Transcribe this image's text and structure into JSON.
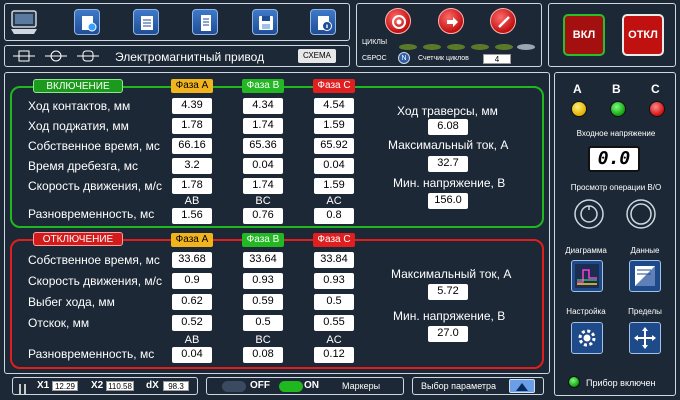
{
  "header": {
    "title": "Электромагнитный привод",
    "scheme_label": "СХЕМА",
    "cycles_label": "ЦИКЛЫ",
    "reset_label": "СБРОС",
    "reset_badge": "N",
    "counter_label": "Счетчик циклов",
    "counter_value": "4",
    "on_label": "ВКЛ",
    "off_label": "ОТКЛ"
  },
  "inclusion": {
    "title": "ВКЛЮЧЕНИЕ",
    "phases": [
      "Фаза A",
      "Фаза B",
      "Фаза C"
    ],
    "rows": [
      {
        "label": "Ход контактов, мм",
        "values": [
          "4.39",
          "4.34",
          "4.54"
        ]
      },
      {
        "label": "Ход поджатия, мм",
        "values": [
          "1.78",
          "1.74",
          "1.59"
        ]
      },
      {
        "label": "Собственное время, мс",
        "values": [
          "66.16",
          "65.36",
          "65.92"
        ]
      },
      {
        "label": "Время дребезга, мс",
        "values": [
          "3.2",
          "0.04",
          "0.04"
        ]
      },
      {
        "label": "Скорость движения, м/с",
        "values": [
          "1.78",
          "1.74",
          "1.59"
        ]
      }
    ],
    "diff_label": "Разновременность, мс",
    "diff_headers": [
      "AB",
      "BC",
      "AC"
    ],
    "diff_values": [
      "1.56",
      "0.76",
      "0.8"
    ],
    "traverse_label": "Ход траверсы, мм",
    "traverse_value": "6.08",
    "max_current_label": "Максимальный ток, А",
    "max_current_value": "32.7",
    "min_voltage_label": "Мин. напряжение, В",
    "min_voltage_value": "156.0"
  },
  "shutdown": {
    "title": "ОТКЛЮЧЕНИЕ",
    "phases": [
      "Фаза A",
      "Фаза B",
      "Фаза C"
    ],
    "rows": [
      {
        "label": "Собственное время, мс",
        "values": [
          "33.68",
          "33.64",
          "33.84"
        ]
      },
      {
        "label": "Скорость движения, м/с",
        "values": [
          "0.9",
          "0.93",
          "0.93"
        ]
      },
      {
        "label": "Выбег хода, мм",
        "values": [
          "0.62",
          "0.59",
          "0.5"
        ]
      },
      {
        "label": "Отскок, мм",
        "values": [
          "0.52",
          "0.5",
          "0.55"
        ]
      }
    ],
    "diff_label": "Разновременность, мс",
    "diff_headers": [
      "AB",
      "BC",
      "AC"
    ],
    "diff_values": [
      "0.04",
      "0.08",
      "0.12"
    ],
    "max_current_label": "Максимальный ток, А",
    "max_current_value": "5.72",
    "min_voltage_label": "Мин. напряжение, В",
    "min_voltage_value": "27.0"
  },
  "right": {
    "phase_letters": [
      "A",
      "B",
      "C"
    ],
    "input_voltage_label": "Входное напряжение",
    "display_value": "0.0",
    "view_label": "Просмотр операции В/О",
    "diagram_label": "Диаграмма",
    "data_label": "Данные",
    "settings_label": "Настройка",
    "limits_label": "Пределы",
    "device_on_label": "Прибор включен"
  },
  "bottom": {
    "x1_label": "X1",
    "x1_value": "12.29",
    "x2_label": "X2",
    "x2_value": "110.58",
    "dx_label": "dX",
    "dx_value": "98.3",
    "off_label": "OFF",
    "on_label": "ON",
    "markers_label": "Маркеры",
    "param_label": "Выбор параметра"
  },
  "colors": {
    "background": "#1c2836",
    "green": "#1fb81f",
    "red": "#e01e1e",
    "phase_a": "#f2b41c"
  }
}
